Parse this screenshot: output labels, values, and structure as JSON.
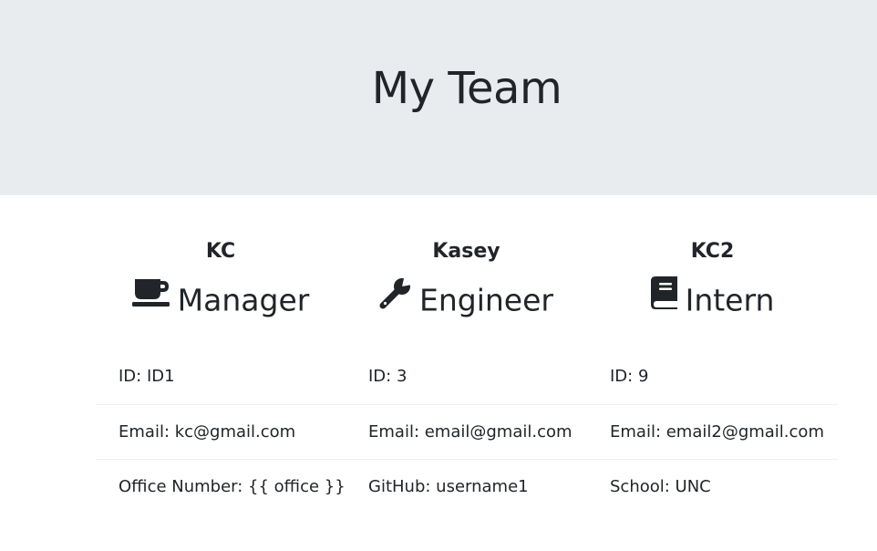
{
  "header": {
    "title": "My Team"
  },
  "cards": [
    {
      "name": "KC",
      "role": "Manager",
      "icon": "coffee-cup-icon",
      "fields": {
        "id": "ID: ID1",
        "email": "Email: kc@gmail.com",
        "extra": "Office Number: {{ office }}"
      }
    },
    {
      "name": "Kasey",
      "role": "Engineer",
      "icon": "wrench-icon",
      "fields": {
        "id": "ID: 3",
        "email": "Email: email@gmail.com",
        "extra": "GitHub: username1"
      }
    },
    {
      "name": "KC2",
      "role": "Intern",
      "icon": "book-icon",
      "fields": {
        "id": "ID: 9",
        "email": "Email: email2@gmail.com",
        "extra": "School: UNC"
      }
    }
  ],
  "colors": {
    "jumbotron_bg": "#e9ecef",
    "text": "#212529",
    "divider": "#eef0f2"
  }
}
